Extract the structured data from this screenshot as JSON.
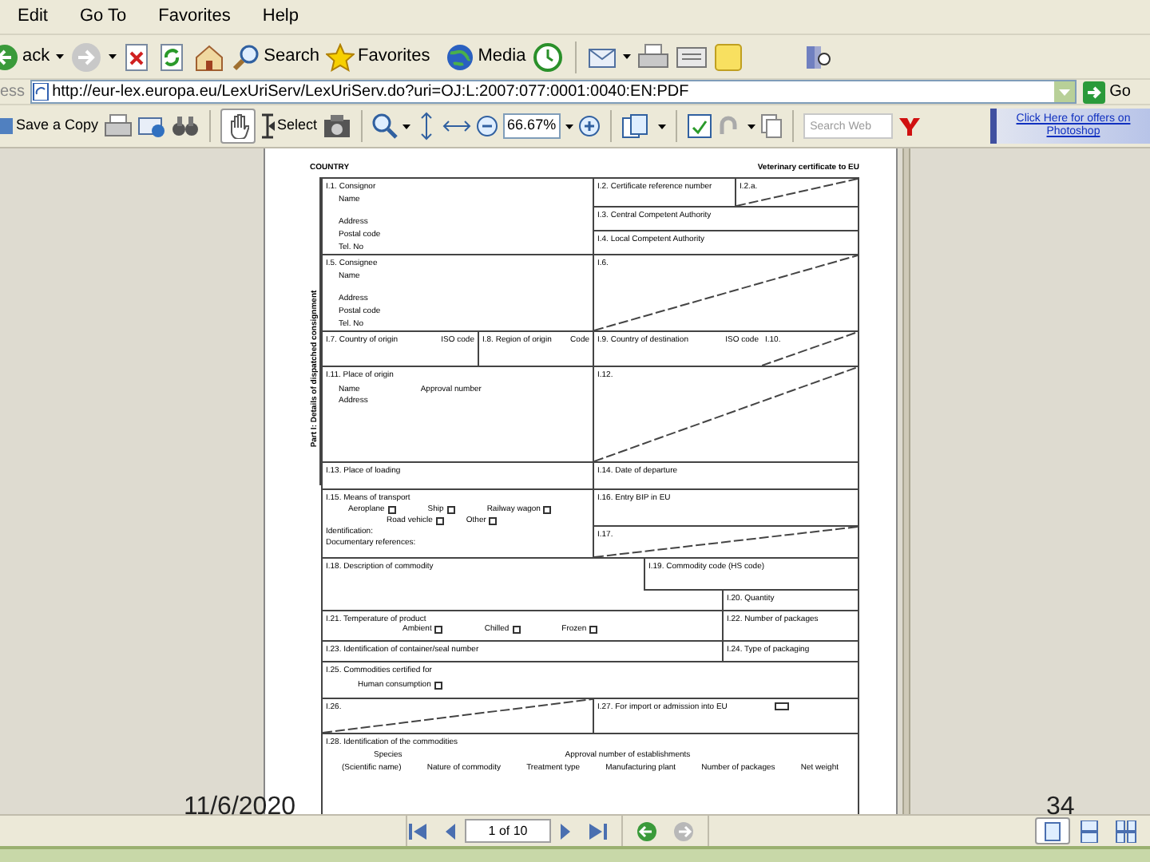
{
  "menu_bar": [
    "Edit",
    "Go To",
    "Favorites",
    "Help"
  ],
  "toolbar": {
    "back": "ack",
    "search": "Search",
    "favorites": "Favorites",
    "media": "Media"
  },
  "address_bar": {
    "label": "ess",
    "url": "http://eur-lex.europa.eu/LexUriServ/LexUriServ.do?uri=OJ:L:2007:077:0001:0040:EN:PDF",
    "go": "Go"
  },
  "reader_toolbar": {
    "save_copy": "Save a Copy",
    "select": "Select",
    "zoom": "66.67%",
    "search_placeholder": "Search Web",
    "ad": "Click Here for offers on Photoshop"
  },
  "document": {
    "heading_left": "COUNTRY",
    "heading_right": "Veterinary certificate to EU",
    "side_label": "Part I: Details of dispatched consignment",
    "consignor": {
      "label": "I.1. Consignor",
      "lines": [
        "Name",
        "Address",
        "Postal code",
        "Tel. No"
      ]
    },
    "certificate_ref": "I.2. Certificate reference number",
    "certificate_ref_a": "I.2.a.",
    "central_authority": "I.3. Central Competent Authority",
    "local_authority": "I.4. Local Competent Authority",
    "consignee": {
      "label": "I.5. Consignee",
      "lines": [
        "Name",
        "Address",
        "Postal code",
        "Tel. No"
      ]
    },
    "box_6": "I.6.",
    "origin_country": "I.7. Country of origin",
    "origin_iso": "ISO code",
    "origin_region": "I.8. Region of origin",
    "region_code": "Code",
    "destination_country": "I.9. Country of destination",
    "destination_iso": "ISO code",
    "box_10": "I.10.",
    "place_of_origin": "I.11. Place of origin",
    "origin_name": "Name",
    "approval_number": "Approval number",
    "origin_address": "Address",
    "box_12": "I.12.",
    "place_of_loading": "I.13. Place of loading",
    "date_of_departure": "I.14. Date of departure",
    "transport": {
      "label": "I.15. Means of transport",
      "options": [
        {
          "label": "Aeroplane",
          "checked": false
        },
        {
          "label": "Ship",
          "checked": false
        },
        {
          "label": "Railway wagon",
          "checked": false
        },
        {
          "label": "Road vehicle",
          "checked": false
        },
        {
          "label": "Other",
          "checked": false
        }
      ],
      "identification": "Identification:",
      "documents": "Documentary references:"
    },
    "entry_bip": "I.16. Entry BIP in EU",
    "box_17": "I.17.",
    "description": "I.18. Description of commodity",
    "commodity_code": "I.19. Commodity code (HS code)",
    "quantity": "I.20. Quantity",
    "temperature": {
      "label": "I.21. Temperature of product",
      "options": [
        {
          "label": "Ambient",
          "checked": false
        },
        {
          "label": "Chilled",
          "checked": false
        },
        {
          "label": "Frozen",
          "checked": false
        }
      ]
    },
    "packages": "I.22. Number of packages",
    "container": "I.23. Identification of container/seal number",
    "packaging": "I.24. Type of packaging",
    "certified_for": {
      "label": "I.25. Commodities certified for",
      "options": [
        {
          "label": "Human consumption",
          "checked": false
        }
      ]
    },
    "box_26": "I.26.",
    "import": {
      "label": "I.27. For import or admission into EU",
      "checked": false
    },
    "identification": {
      "label": "I.28. Identification of the commodities",
      "species": "Species",
      "approval": "Approval number of establishments",
      "columns": [
        "(Scientific name)",
        "Nature of commodity",
        "Treatment type",
        "Manufacturing plant",
        "Number of packages",
        "Net weight"
      ]
    }
  },
  "page_nav": {
    "page_field": "1 of 10"
  },
  "slide": {
    "date": "11/6/2020",
    "page_number": "34"
  }
}
